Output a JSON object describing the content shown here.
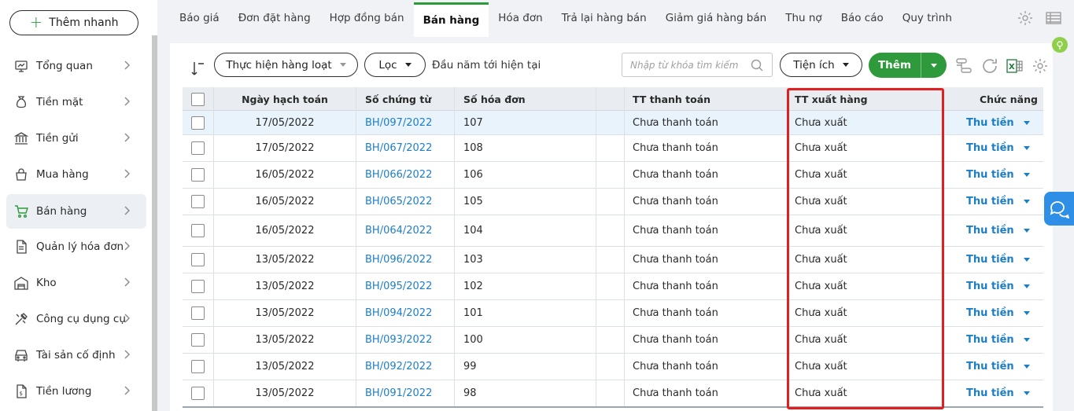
{
  "sidebar": {
    "quick_add_label": "Thêm nhanh",
    "items": [
      {
        "label": "Tổng quan",
        "icon": "dashboard-icon"
      },
      {
        "label": "Tiền mặt",
        "icon": "money-bag-icon"
      },
      {
        "label": "Tiền gửi",
        "icon": "bank-icon"
      },
      {
        "label": "Mua hàng",
        "icon": "shopping-bag-icon"
      },
      {
        "label": "Bán hàng",
        "icon": "cart-icon"
      },
      {
        "label": "Quản lý hóa đơn",
        "icon": "invoice-icon"
      },
      {
        "label": "Kho",
        "icon": "warehouse-icon"
      },
      {
        "label": "Công cụ dụng cụ",
        "icon": "tools-icon"
      },
      {
        "label": "Tài sản cố định",
        "icon": "car-icon"
      },
      {
        "label": "Tiền lương",
        "icon": "salary-icon"
      }
    ]
  },
  "tabs": [
    "Báo giá",
    "Đơn đặt hàng",
    "Hợp đồng bán",
    "Bán hàng",
    "Hóa đơn",
    "Trả lại hàng bán",
    "Giảm giá hàng bán",
    "Thu nợ",
    "Báo cáo",
    "Quy trình"
  ],
  "toolbar": {
    "batch_label": "Thực hiện hàng loạt",
    "filter_label": "Lọc",
    "range_label": "Đầu năm tới hiện tại",
    "search_placeholder": "Nhập từ khóa tìm kiếm",
    "utility_label": "Tiện ích",
    "add_label": "Thêm"
  },
  "table": {
    "headers": {
      "date": "Ngày hạch toán",
      "voucher": "Số chứng từ",
      "invoice": "Số hóa đơn",
      "payment": "TT thanh toán",
      "delivery": "TT xuất hàng",
      "actions": "Chức năng"
    },
    "rows": [
      {
        "date": "17/05/2022",
        "voucher": "BH/097/2022",
        "invoice": "107",
        "payment": "Chưa thanh toán",
        "delivery": "Chưa xuất",
        "action": "Thu tiền"
      },
      {
        "date": "17/05/2022",
        "voucher": "BH/067/2022",
        "invoice": "108",
        "payment": "Chưa thanh toán",
        "delivery": "Chưa xuất",
        "action": "Thu tiền"
      },
      {
        "date": "16/05/2022",
        "voucher": "BH/066/2022",
        "invoice": "106",
        "payment": "Chưa thanh toán",
        "delivery": "Chưa xuất",
        "action": "Thu tiền"
      },
      {
        "date": "16/05/2022",
        "voucher": "BH/065/2022",
        "invoice": "105",
        "payment": "Chưa thanh toán",
        "delivery": "Chưa xuất",
        "action": "Thu tiền"
      },
      {
        "date": "16/05/2022",
        "voucher": "BH/064/2022",
        "invoice": "104",
        "payment": "Chưa thanh toán",
        "delivery": "Chưa xuất",
        "action": "Thu tiền"
      },
      {
        "date": "13/05/2022",
        "voucher": "BH/096/2022",
        "invoice": "103",
        "payment": "Chưa thanh toán",
        "delivery": "Chưa xuất",
        "action": "Thu tiền"
      },
      {
        "date": "13/05/2022",
        "voucher": "BH/095/2022",
        "invoice": "102",
        "payment": "Chưa thanh toán",
        "delivery": "Chưa xuất",
        "action": "Thu tiền"
      },
      {
        "date": "13/05/2022",
        "voucher": "BH/094/2022",
        "invoice": "101",
        "payment": "Chưa thanh toán",
        "delivery": "Chưa xuất",
        "action": "Thu tiền"
      },
      {
        "date": "13/05/2022",
        "voucher": "BH/093/2022",
        "invoice": "100",
        "payment": "Chưa thanh toán",
        "delivery": "Chưa xuất",
        "action": "Thu tiền"
      },
      {
        "date": "13/05/2022",
        "voucher": "BH/092/2022",
        "invoice": "99",
        "payment": "Chưa thanh toán",
        "delivery": "Chưa xuất",
        "action": "Thu tiền"
      },
      {
        "date": "13/05/2022",
        "voucher": "BH/091/2022",
        "invoice": "98",
        "payment": "Chưa thanh toán",
        "delivery": "Chưa xuất",
        "action": "Thu tiền"
      }
    ]
  },
  "colors": {
    "accent_green": "#2e9a3c",
    "link_blue": "#1d7ec8",
    "highlight_red": "#e02020"
  }
}
